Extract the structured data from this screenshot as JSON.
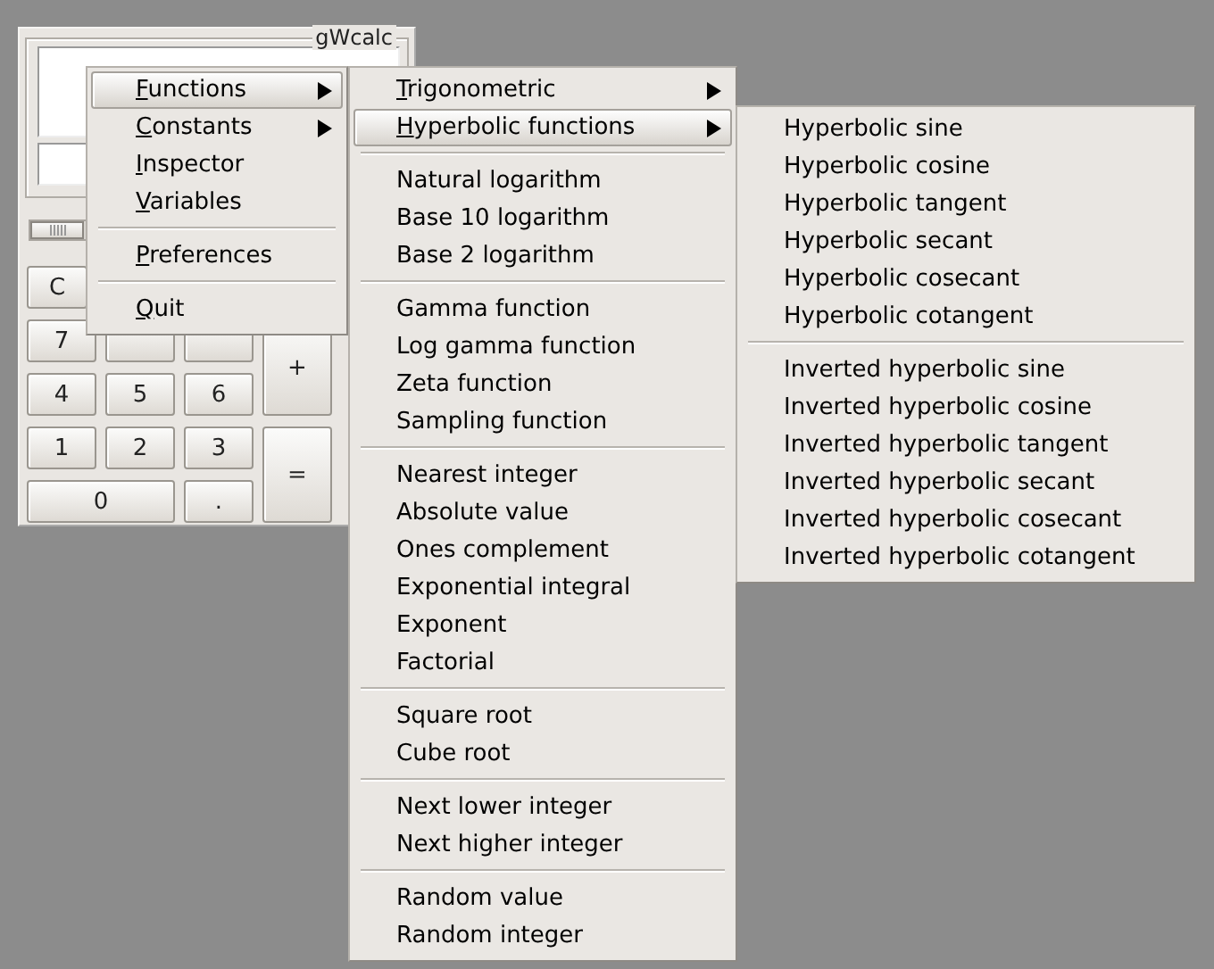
{
  "window": {
    "title": "gWcalc"
  },
  "calculator": {
    "buttons": [
      {
        "label": "C",
        "kind": "normal"
      },
      {
        "label": "7",
        "kind": "normal"
      },
      {
        "kind": "normal"
      },
      {
        "kind": "normal"
      },
      {
        "label": "+",
        "kind": "tall"
      },
      {
        "label": "4",
        "kind": "normal"
      },
      {
        "label": "5",
        "kind": "normal"
      },
      {
        "label": "6",
        "kind": "normal"
      },
      {
        "label": "1",
        "kind": "normal"
      },
      {
        "label": "2",
        "kind": "normal"
      },
      {
        "label": "3",
        "kind": "normal"
      },
      {
        "label": "=",
        "kind": "tall"
      },
      {
        "label": "0",
        "kind": "wide"
      },
      {
        "label": ".",
        "kind": "normal"
      }
    ]
  },
  "menus": [
    {
      "items": [
        {
          "kind": "item",
          "label": "Functions",
          "mnemonic": true,
          "submenu": true,
          "selected": true
        },
        {
          "kind": "item",
          "label": "Constants",
          "mnemonic": true,
          "submenu": true,
          "selected": false
        },
        {
          "kind": "item",
          "label": "Inspector",
          "mnemonic": true,
          "submenu": false,
          "selected": false
        },
        {
          "kind": "item",
          "label": "Variables",
          "mnemonic": true,
          "submenu": false,
          "selected": false
        },
        {
          "kind": "separator"
        },
        {
          "kind": "item",
          "label": "Preferences",
          "mnemonic": true,
          "submenu": false,
          "selected": false
        },
        {
          "kind": "separator"
        },
        {
          "kind": "item",
          "label": "Quit",
          "mnemonic": true,
          "submenu": false,
          "selected": false
        }
      ]
    },
    {
      "items": [
        {
          "kind": "item",
          "label": "Trigonometric",
          "mnemonic": true,
          "submenu": true,
          "selected": false
        },
        {
          "kind": "item",
          "label": "Hyperbolic functions",
          "mnemonic": true,
          "submenu": true,
          "selected": true
        },
        {
          "kind": "separator"
        },
        {
          "kind": "item",
          "label": "Natural logarithm",
          "mnemonic": false,
          "submenu": false,
          "selected": false
        },
        {
          "kind": "item",
          "label": "Base 10 logarithm",
          "mnemonic": false,
          "submenu": false,
          "selected": false
        },
        {
          "kind": "item",
          "label": "Base 2 logarithm",
          "mnemonic": false,
          "submenu": false,
          "selected": false
        },
        {
          "kind": "separator"
        },
        {
          "kind": "item",
          "label": "Gamma function",
          "mnemonic": false,
          "submenu": false,
          "selected": false
        },
        {
          "kind": "item",
          "label": "Log gamma function",
          "mnemonic": false,
          "submenu": false,
          "selected": false
        },
        {
          "kind": "item",
          "label": "Zeta function",
          "mnemonic": false,
          "submenu": false,
          "selected": false
        },
        {
          "kind": "item",
          "label": "Sampling function",
          "mnemonic": false,
          "submenu": false,
          "selected": false
        },
        {
          "kind": "separator"
        },
        {
          "kind": "item",
          "label": "Nearest integer",
          "mnemonic": false,
          "submenu": false,
          "selected": false
        },
        {
          "kind": "item",
          "label": "Absolute value",
          "mnemonic": false,
          "submenu": false,
          "selected": false
        },
        {
          "kind": "item",
          "label": "Ones complement",
          "mnemonic": false,
          "submenu": false,
          "selected": false
        },
        {
          "kind": "item",
          "label": "Exponential integral",
          "mnemonic": false,
          "submenu": false,
          "selected": false
        },
        {
          "kind": "item",
          "label": "Exponent",
          "mnemonic": false,
          "submenu": false,
          "selected": false
        },
        {
          "kind": "item",
          "label": "Factorial",
          "mnemonic": false,
          "submenu": false,
          "selected": false
        },
        {
          "kind": "separator"
        },
        {
          "kind": "item",
          "label": "Square root",
          "mnemonic": false,
          "submenu": false,
          "selected": false
        },
        {
          "kind": "item",
          "label": "Cube root",
          "mnemonic": false,
          "submenu": false,
          "selected": false
        },
        {
          "kind": "separator"
        },
        {
          "kind": "item",
          "label": "Next lower integer",
          "mnemonic": false,
          "submenu": false,
          "selected": false
        },
        {
          "kind": "item",
          "label": "Next higher integer",
          "mnemonic": false,
          "submenu": false,
          "selected": false
        },
        {
          "kind": "separator"
        },
        {
          "kind": "item",
          "label": "Random value",
          "mnemonic": false,
          "submenu": false,
          "selected": false
        },
        {
          "kind": "item",
          "label": "Random integer",
          "mnemonic": false,
          "submenu": false,
          "selected": false
        }
      ]
    },
    {
      "items": [
        {
          "kind": "item",
          "label": "Hyperbolic sine",
          "mnemonic": false,
          "submenu": false,
          "selected": false
        },
        {
          "kind": "item",
          "label": "Hyperbolic cosine",
          "mnemonic": false,
          "submenu": false,
          "selected": false
        },
        {
          "kind": "item",
          "label": "Hyperbolic tangent",
          "mnemonic": false,
          "submenu": false,
          "selected": false
        },
        {
          "kind": "item",
          "label": "Hyperbolic secant",
          "mnemonic": false,
          "submenu": false,
          "selected": false
        },
        {
          "kind": "item",
          "label": "Hyperbolic cosecant",
          "mnemonic": false,
          "submenu": false,
          "selected": false
        },
        {
          "kind": "item",
          "label": "Hyperbolic cotangent",
          "mnemonic": false,
          "submenu": false,
          "selected": false
        },
        {
          "kind": "separator"
        },
        {
          "kind": "item",
          "label": "Inverted hyperbolic sine",
          "mnemonic": false,
          "submenu": false,
          "selected": false
        },
        {
          "kind": "item",
          "label": "Inverted hyperbolic cosine",
          "mnemonic": false,
          "submenu": false,
          "selected": false
        },
        {
          "kind": "item",
          "label": "Inverted hyperbolic tangent",
          "mnemonic": false,
          "submenu": false,
          "selected": false
        },
        {
          "kind": "item",
          "label": "Inverted hyperbolic secant",
          "mnemonic": false,
          "submenu": false,
          "selected": false
        },
        {
          "kind": "item",
          "label": "Inverted hyperbolic cosecant",
          "mnemonic": false,
          "submenu": false,
          "selected": false
        },
        {
          "kind": "item",
          "label": "Inverted hyperbolic cotangent",
          "mnemonic": false,
          "submenu": false,
          "selected": false
        }
      ]
    }
  ]
}
